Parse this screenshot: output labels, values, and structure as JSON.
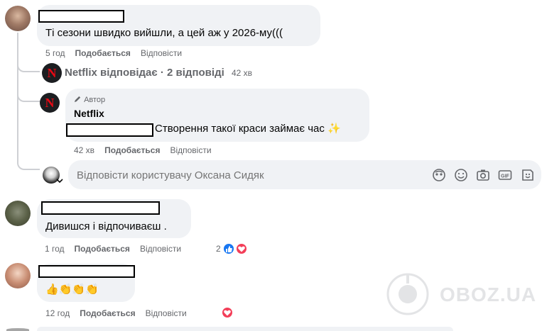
{
  "comment1": {
    "text": "Ті сезони швидко вийшли, а цей аж у 2026-му(((",
    "time": "5 год",
    "like_label": "Подобається",
    "reply_label": "Відповісти"
  },
  "netflix_summary": {
    "name": "Netflix відповідає",
    "separator": " · ",
    "replies": "2 відповіді",
    "time": "42 хв"
  },
  "reply1": {
    "badge": "Автор",
    "author": "Netflix",
    "text": "Створення такої краси займає час ✨",
    "time": "42 хв",
    "like_label": "Подобається",
    "reply_label": "Відповісти"
  },
  "reply_input": {
    "placeholder": "Відповісти користувачу Оксана Сидяк"
  },
  "comment2": {
    "text": "Дивишся і відпочиваєш .",
    "time": "1 год",
    "like_label": "Подобається",
    "reply_label": "Відповісти",
    "reaction_count": "2"
  },
  "comment3": {
    "text": "👍👏👏👏",
    "time": "12 год",
    "like_label": "Подобається",
    "reply_label": "Відповісти"
  },
  "watermark": "OBOZ.UA",
  "colors": {
    "bubble": "#f0f2f5",
    "meta": "#65676b",
    "like_blue": "#1877f2",
    "heart_red": "#f33e58",
    "netflix_red": "#e50914"
  }
}
